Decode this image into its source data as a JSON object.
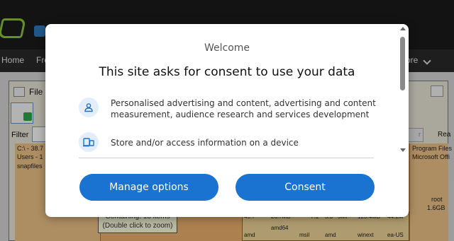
{
  "site": {
    "nav": [
      "Home",
      "Fre",
      "ore"
    ]
  },
  "app": {
    "title": "File",
    "filter_label": "Filter",
    "right_label": "Rea",
    "right_field": "r",
    "treemap": {
      "path": "C:\\ - 38.7",
      "users": "Users - 1",
      "snapfiles": "snapfiles",
      "right_items": [
        "Program Files",
        "Microsoft Offi",
        "root",
        "1.6GB"
      ],
      "cells": [
        "49.7",
        "26.7MB",
        "44.1M",
        "125.4MB",
        "7.1",
        "5.3",
        "5MI",
        "amd64",
        "amd",
        "amd",
        "msil",
        "winext",
        "ea-US"
      ]
    },
    "tooltip_line1": "Containing: 18 items",
    "tooltip_line2": "(Double click to zoom)"
  },
  "dialog": {
    "welcome": "Welcome",
    "heading": "This site asks for consent to use your data",
    "purposes": [
      {
        "icon": "person-icon",
        "text": "Personalised advertising and content, advertising and content measurement, audience research and services development"
      },
      {
        "icon": "devices-icon",
        "text": "Store and/or access information on a device"
      }
    ],
    "manage_label": "Manage options",
    "consent_label": "Consent",
    "accent": "#1a73d0"
  }
}
